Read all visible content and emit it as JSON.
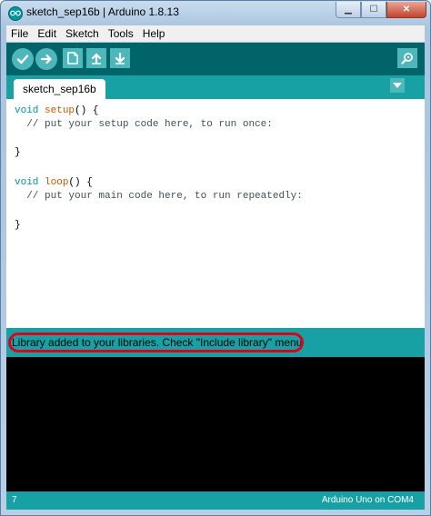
{
  "window": {
    "title": "sketch_sep16b | Arduino 1.8.13",
    "controls": {
      "minimize": "▁",
      "maximize": "☐",
      "close": "✕"
    }
  },
  "menubar": {
    "items": [
      {
        "label": "File"
      },
      {
        "label": "Edit"
      },
      {
        "label": "Sketch"
      },
      {
        "label": "Tools"
      },
      {
        "label": "Help"
      }
    ]
  },
  "toolbar": {
    "buttons": [
      "verify-icon",
      "upload-icon",
      "new-icon",
      "open-icon",
      "save-icon"
    ],
    "right_button": "serial-monitor-icon"
  },
  "tabs": [
    {
      "label": "sketch_sep16b"
    }
  ],
  "editor": {
    "lines": {
      "setup_sig_kw": "void ",
      "setup_sig_fn": "setup",
      "setup_sig_rest": "() {",
      "setup_comment": "  // put your setup code here, to run once:",
      "setup_close": "}",
      "loop_sig_kw": "void ",
      "loop_sig_fn": "loop",
      "loop_sig_rest": "() {",
      "loop_comment": "  // put your main code here, to run repeatedly:",
      "loop_close": "}"
    }
  },
  "status": {
    "message": "Library added to your libraries. Check \"Include library\" menu"
  },
  "bottom": {
    "line_number": "7",
    "board": "Arduino Uno on COM4"
  },
  "colors": {
    "toolbar": "#006468",
    "tabbar": "#17a1a5",
    "button": "#4db7bb",
    "highlight": "#e0001a"
  }
}
